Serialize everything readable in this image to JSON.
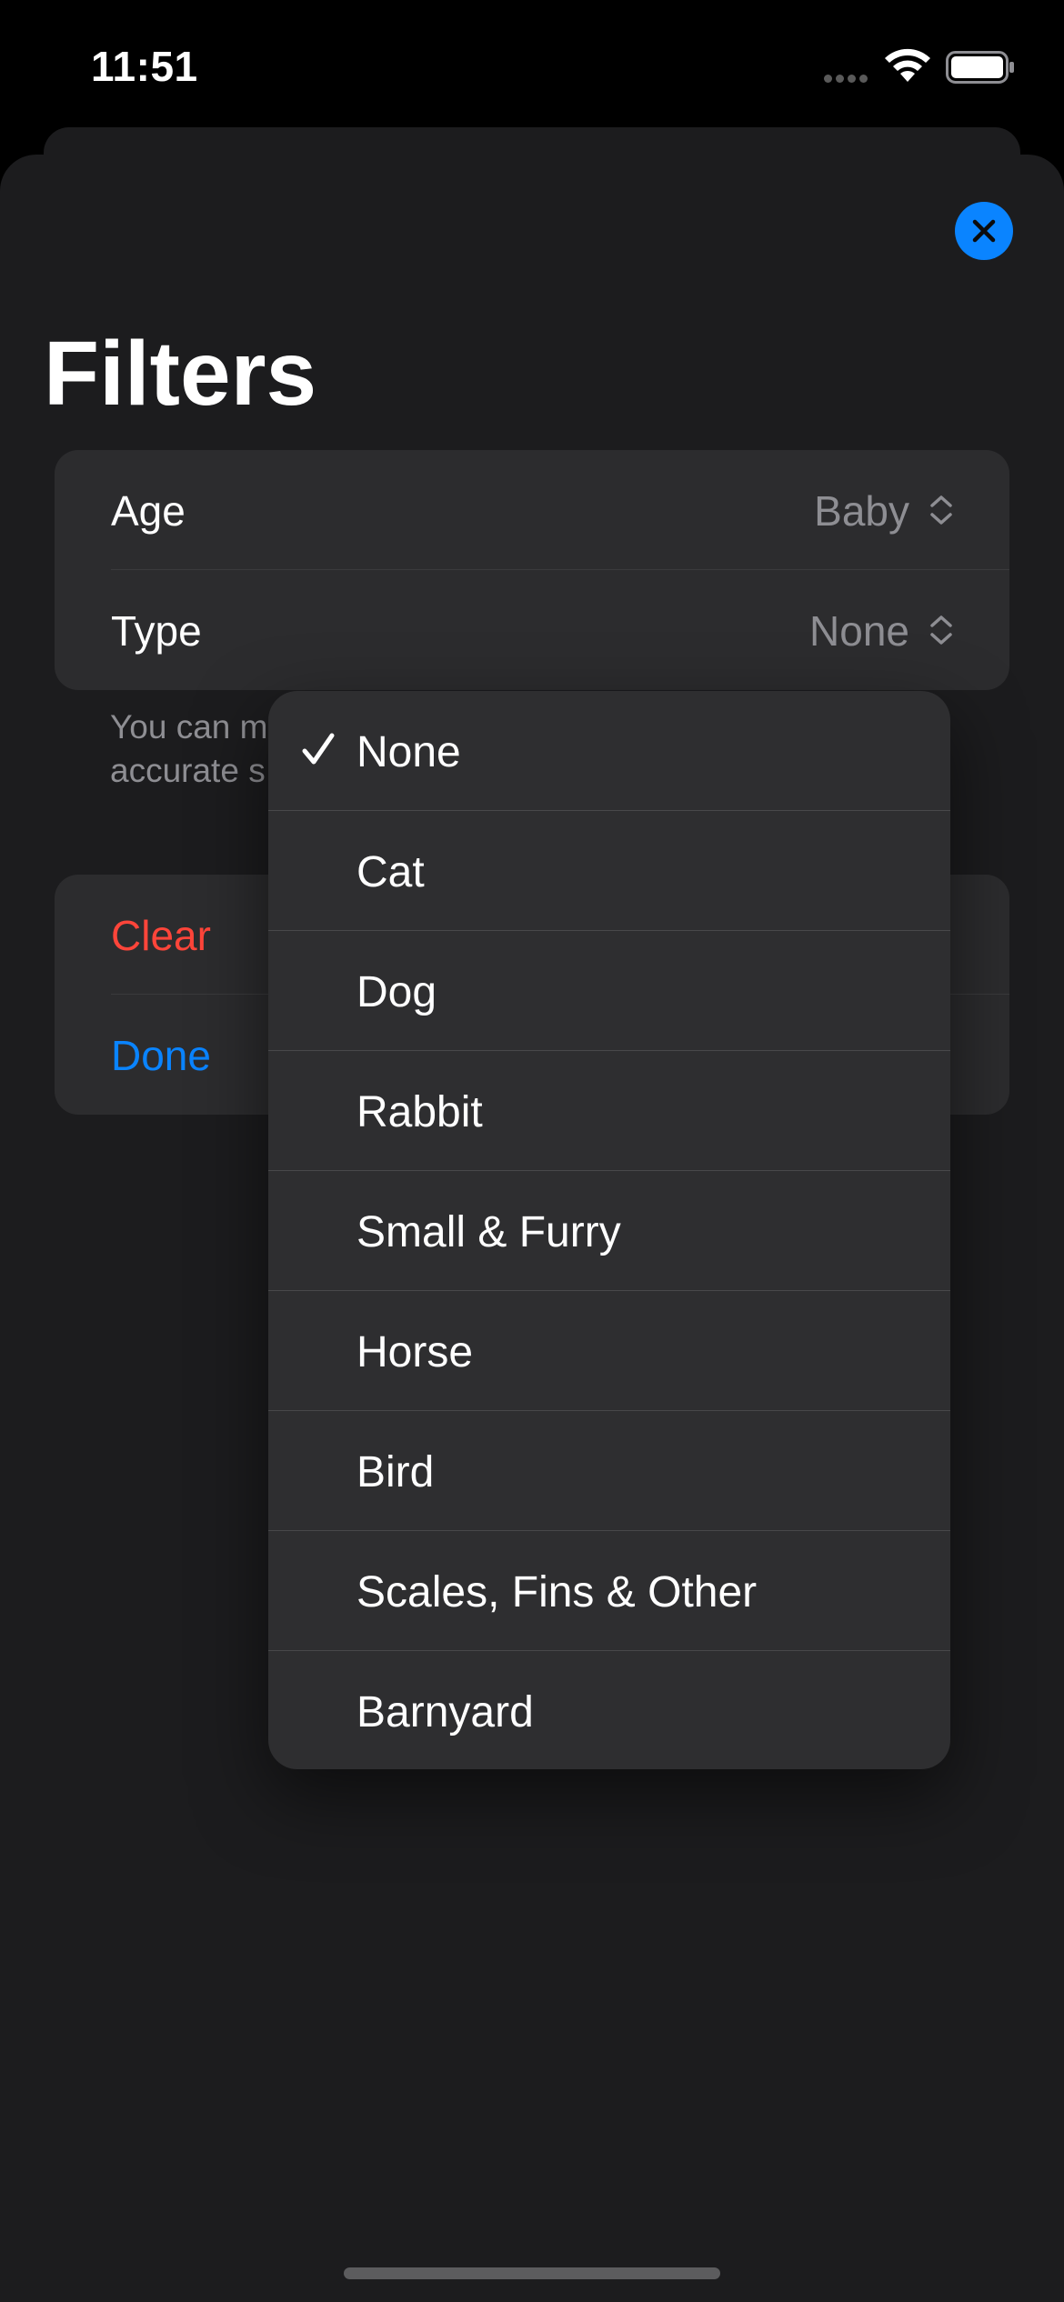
{
  "status_bar": {
    "time": "11:51"
  },
  "sheet": {
    "title": "Filters",
    "close_icon": "close-icon",
    "accent_color": "#0a84ff"
  },
  "filters": {
    "rows": [
      {
        "label": "Age",
        "value": "Baby"
      },
      {
        "label": "Type",
        "value": "None"
      }
    ],
    "footer_line1": "You can m",
    "footer_line2": "accurate s"
  },
  "actions": {
    "clear_label": "Clear",
    "clear_color": "#ff453a",
    "done_label": "Done",
    "done_color": "#0a84ff"
  },
  "type_menu": {
    "selected": "None",
    "options": [
      "None",
      "Cat",
      "Dog",
      "Rabbit",
      "Small & Furry",
      "Horse",
      "Bird",
      "Scales, Fins & Other",
      "Barnyard"
    ]
  }
}
